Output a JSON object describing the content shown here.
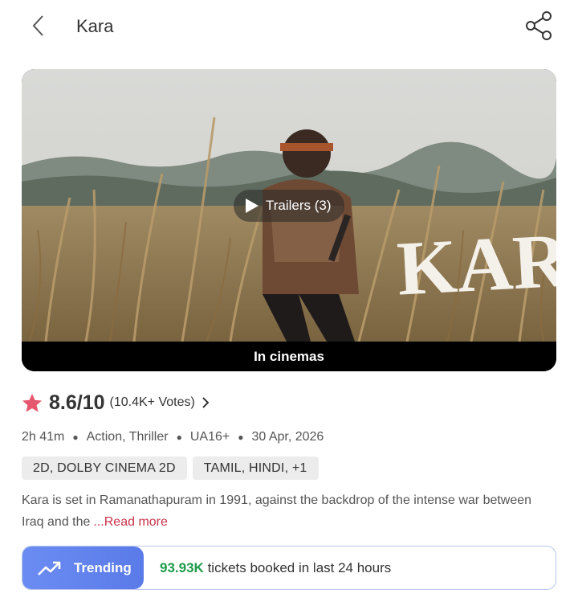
{
  "header": {
    "title": "Kara"
  },
  "banner": {
    "poster_title": "KARA",
    "trailer_label": "Trailers (3)",
    "status_label": "In cinemas"
  },
  "rating": {
    "score": "8.6/10",
    "votes": "(10.4K+ Votes)"
  },
  "meta": {
    "duration": "2h 41m",
    "genres": "Action, Thriller",
    "certificate": "UA16+",
    "release_date": "30 Apr, 2026"
  },
  "tags": {
    "formats": "2D, DOLBY CINEMA 2D",
    "languages": "TAMIL, HINDI,  +1"
  },
  "description": {
    "text": "Kara is set in Ramanathapuram in 1991, against the backdrop of the intense war between Iraq and the",
    "read_more": "...Read more"
  },
  "trending": {
    "label": "Trending",
    "count": "93.93K",
    "text": "tickets booked in last 24 hours"
  },
  "colors": {
    "accent_red": "#c8344a",
    "trend_blue": "#6b8cf2",
    "trend_green": "#1f9b49"
  }
}
